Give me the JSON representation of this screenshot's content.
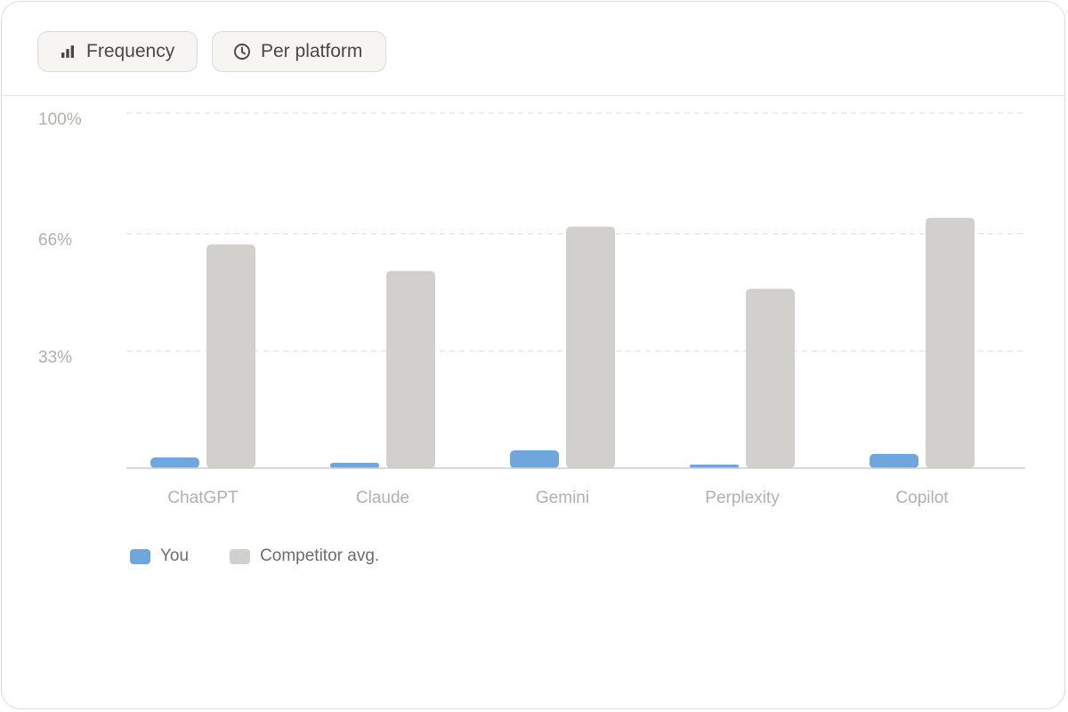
{
  "toolbar": {
    "frequency_label": "Frequency",
    "frequency_icon": "bar-chart-icon",
    "platform_label": "Per platform",
    "platform_icon": "clock-icon"
  },
  "colors": {
    "you": "#6fa6de",
    "competitor": "#d1d0cc",
    "grid": "#e4e2de",
    "axis": "#cfcdc9",
    "tick_text": "#b3b0ab"
  },
  "chart_data": {
    "type": "bar",
    "categories": [
      "ChatGPT",
      "Claude",
      "Gemini",
      "Perplexity",
      "Copilot"
    ],
    "series": [
      {
        "name": "You",
        "values": [
          3,
          1.5,
          5,
          1,
          4
        ]
      },
      {
        "name": "Competitor avg.",
        "values": [
          63,
          55.5,
          68,
          50.5,
          70.5
        ]
      }
    ],
    "ylim": [
      0,
      100
    ],
    "yticks": [
      {
        "value": 100,
        "label": "100%"
      },
      {
        "value": 66,
        "label": "66%"
      },
      {
        "value": 33,
        "label": "33%"
      }
    ],
    "grid": true,
    "legend_position": "bottom-left"
  }
}
